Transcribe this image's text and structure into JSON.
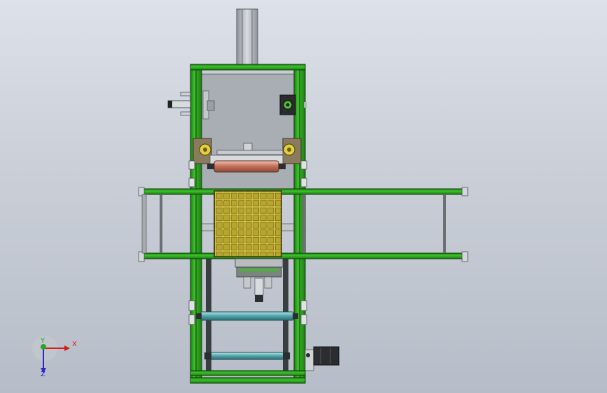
{
  "viewport": {
    "background_top": "#dde1e8",
    "background_bottom": "#b7bdc8"
  },
  "colors": {
    "frame_green": "#2fb21f",
    "frame_green_dark": "#1c6d12",
    "rail_dark": "#3a3d3f",
    "panel_grey": "#a8acb3",
    "plate_grey": "#9ea2a9",
    "roller_red": "#c98570",
    "roller_cyan": "#5fb3b9",
    "grid_yellow": "#cdbd42",
    "column_grey": "#b9bec4"
  },
  "triad": {
    "x_label": "X",
    "y_label": "Y",
    "z_label": "Z",
    "x_color": "#d01c1c",
    "y_color": "#2aa52a",
    "z_color": "#2828c8"
  }
}
